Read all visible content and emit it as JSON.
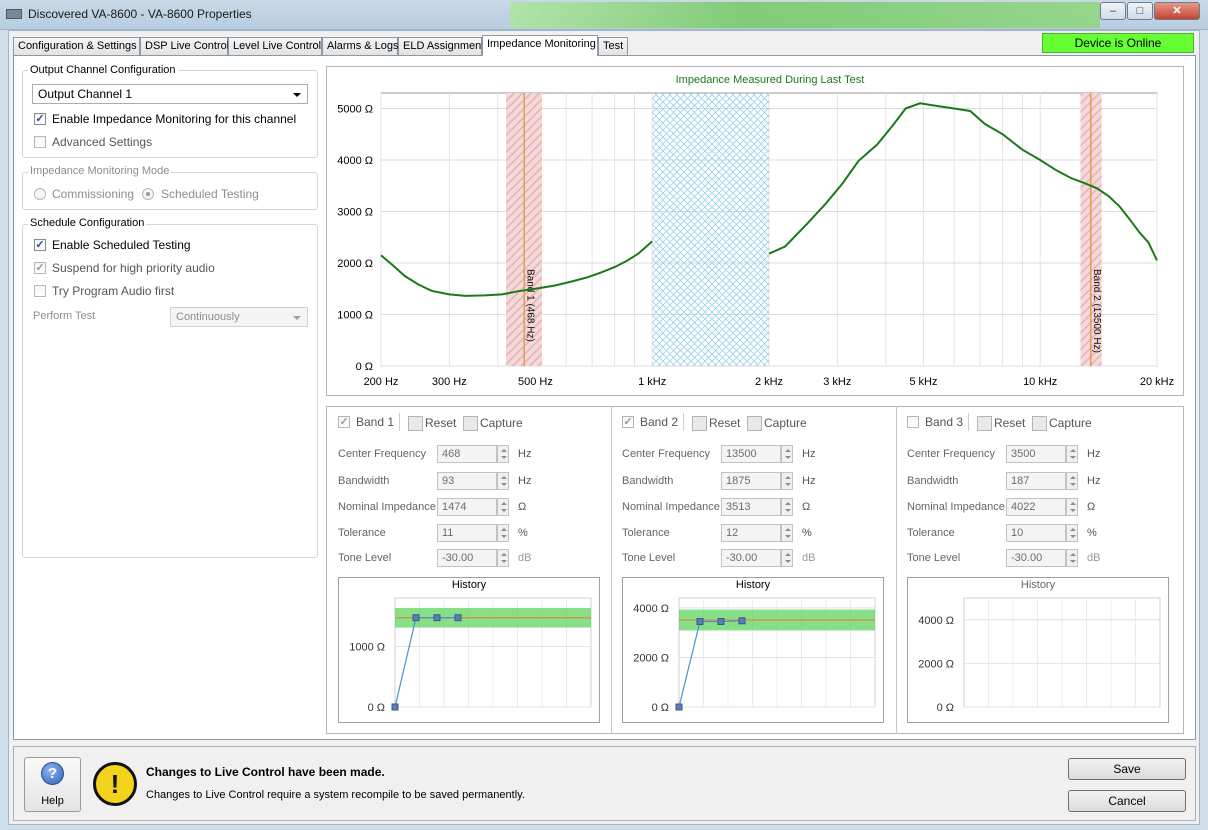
{
  "window": {
    "title": "Discovered VA-8600 - VA-8600 Properties",
    "controls": {
      "minimize": "–",
      "maximize": "□",
      "close": "✕"
    }
  },
  "tabs": [
    {
      "label": "Configuration & Settings"
    },
    {
      "label": "DSP Live Control"
    },
    {
      "label": "Level Live Control"
    },
    {
      "label": "Alarms & Logs"
    },
    {
      "label": "ELD Assignment"
    },
    {
      "label": "Impedance Monitoring",
      "active": true
    },
    {
      "label": "Test"
    }
  ],
  "status_badge": "Device is Online",
  "colors": {
    "online": "#66ff33",
    "curve": "#1a7a1a",
    "band_marker": "#e69b4f",
    "band_fill": "#e7b1b1",
    "hatch": "#9bd0e8",
    "tolerance": "#5fd65f"
  },
  "output_channel": {
    "group_label": "Output Channel Configuration",
    "selected": "Output Channel 1",
    "enable_label": "Enable Impedance Monitoring for this channel",
    "enable_checked": true,
    "advanced_label": "Advanced Settings",
    "advanced_checked": false
  },
  "monitoring_mode": {
    "group_label": "Impedance Monitoring Mode",
    "commissioning": "Commissioning",
    "scheduled": "Scheduled Testing",
    "selected": "Scheduled Testing"
  },
  "schedule": {
    "group_label": "Schedule Configuration",
    "enable_label": "Enable Scheduled Testing",
    "enable_checked": true,
    "suspend_label": "Suspend for high priority audio",
    "suspend_checked": true,
    "program_label": "Try Program Audio first",
    "program_checked": false,
    "perform_label": "Perform Test",
    "perform_value": "Continuously"
  },
  "chart_data": {
    "type": "line",
    "title": "Impedance Measured During Last Test",
    "x_scale": "log",
    "xlim": [
      200,
      20000
    ],
    "ylim": [
      0,
      5300
    ],
    "x_ticks": [
      {
        "v": 200,
        "label": "200 Hz"
      },
      {
        "v": 300,
        "label": "300 Hz"
      },
      {
        "v": 500,
        "label": "500 Hz"
      },
      {
        "v": 1000,
        "label": "1 kHz"
      },
      {
        "v": 2000,
        "label": "2 kHz"
      },
      {
        "v": 3000,
        "label": "3 kHz"
      },
      {
        "v": 5000,
        "label": "5 kHz"
      },
      {
        "v": 10000,
        "label": "10 kHz"
      },
      {
        "v": 20000,
        "label": "20 kHz"
      }
    ],
    "y_ticks": [
      {
        "v": 0,
        "label": "0 Ω"
      },
      {
        "v": 1000,
        "label": "1000 Ω"
      },
      {
        "v": 2000,
        "label": "2000 Ω"
      },
      {
        "v": 3000,
        "label": "3000 Ω"
      },
      {
        "v": 4000,
        "label": "4000 Ω"
      },
      {
        "v": 5000,
        "label": "5000 Ω"
      }
    ],
    "grid": true,
    "series": [
      {
        "segments": [
          [
            [
              200,
              2150
            ],
            [
              215,
              1950
            ],
            [
              230,
              1750
            ],
            [
              250,
              1580
            ],
            [
              270,
              1460
            ],
            [
              300,
              1390
            ],
            [
              330,
              1360
            ],
            [
              370,
              1370
            ],
            [
              410,
              1390
            ],
            [
              450,
              1450
            ],
            [
              500,
              1500
            ],
            [
              560,
              1560
            ],
            [
              620,
              1640
            ],
            [
              680,
              1720
            ],
            [
              740,
              1820
            ],
            [
              800,
              1920
            ],
            [
              860,
              2040
            ],
            [
              920,
              2180
            ],
            [
              960,
              2300
            ],
            [
              1000,
              2420
            ]
          ],
          [
            [
              2000,
              2180
            ],
            [
              2200,
              2320
            ],
            [
              2500,
              2750
            ],
            [
              2800,
              3150
            ],
            [
              3100,
              3550
            ],
            [
              3400,
              3980
            ],
            [
              3800,
              4300
            ],
            [
              4200,
              4700
            ],
            [
              4500,
              5000
            ],
            [
              4900,
              5100
            ],
            [
              5400,
              5050
            ],
            [
              6000,
              5000
            ],
            [
              6600,
              4950
            ],
            [
              7200,
              4700
            ],
            [
              8000,
              4500
            ],
            [
              9000,
              4200
            ],
            [
              10000,
              4000
            ],
            [
              11000,
              3800
            ],
            [
              12000,
              3650
            ],
            [
              13000,
              3550
            ],
            [
              14000,
              3450
            ],
            [
              15000,
              3300
            ],
            [
              16000,
              3100
            ],
            [
              17000,
              2850
            ],
            [
              18000,
              2600
            ],
            [
              19000,
              2400
            ],
            [
              20000,
              2050
            ]
          ]
        ]
      }
    ],
    "bands": [
      {
        "label": "Band 1 (468 Hz)",
        "center": 468,
        "low": 420,
        "high": 520
      },
      {
        "label": "Band 2 (13500 Hz)",
        "center": 13500,
        "low": 12700,
        "high": 14400
      }
    ],
    "excluded_region": [
      1000,
      2000
    ]
  },
  "band_panels": [
    {
      "name": "Band 1",
      "checked": true,
      "enabled": true,
      "reset": "Reset",
      "capture": "Capture",
      "center_label": "Center Frequency",
      "center": "468",
      "center_unit": "Hz",
      "bw_label": "Bandwidth",
      "bw": "93",
      "bw_unit": "Hz",
      "nom_label": "Nominal Impedance",
      "nom": "1474",
      "nom_unit": "Ω",
      "tol_label": "Tolerance",
      "tol": "11",
      "tol_unit": "%",
      "tone_label": "Tone Level",
      "tone": "-30.00",
      "tone_unit": "dB",
      "history": {
        "title": "History",
        "ylim": [
          0,
          1800
        ],
        "y_ticks": [
          {
            "v": 0,
            "label": "0 Ω"
          },
          {
            "v": 1000,
            "label": "1000 Ω"
          }
        ],
        "nominal": 1474,
        "tolerance": 11,
        "points": [
          0,
          1474,
          1474,
          1474
        ]
      }
    },
    {
      "name": "Band 2",
      "checked": true,
      "enabled": true,
      "reset": "Reset",
      "capture": "Capture",
      "center_label": "Center Frequency",
      "center": "13500",
      "center_unit": "Hz",
      "bw_label": "Bandwidth",
      "bw": "1875",
      "bw_unit": "Hz",
      "nom_label": "Nominal Impedance",
      "nom": "3513",
      "nom_unit": "Ω",
      "tol_label": "Tolerance",
      "tol": "12",
      "tol_unit": "%",
      "tone_label": "Tone Level",
      "tone": "-30.00",
      "tone_unit": "dB",
      "history": {
        "title": "History",
        "ylim": [
          0,
          4400
        ],
        "y_ticks": [
          {
            "v": 0,
            "label": "0 Ω"
          },
          {
            "v": 2000,
            "label": "2000 Ω"
          },
          {
            "v": 4000,
            "label": "4000 Ω"
          }
        ],
        "nominal": 3513,
        "tolerance": 12,
        "points": [
          0,
          3450,
          3450,
          3480
        ]
      }
    },
    {
      "name": "Band 3",
      "checked": false,
      "enabled": false,
      "reset": "Reset",
      "capture": "Capture",
      "center_label": "Center Frequency",
      "center": "3500",
      "center_unit": "Hz",
      "bw_label": "Bandwidth",
      "bw": "187",
      "bw_unit": "Hz",
      "nom_label": "Nominal Impedance",
      "nom": "4022",
      "nom_unit": "Ω",
      "tol_label": "Tolerance",
      "tol": "10",
      "tol_unit": "%",
      "tone_label": "Tone Level",
      "tone": "-30.00",
      "tone_unit": "dB",
      "history": {
        "title": "History",
        "ylim": [
          0,
          5000
        ],
        "y_ticks": [
          {
            "v": 0,
            "label": "0 Ω"
          },
          {
            "v": 2000,
            "label": "2000 Ω"
          },
          {
            "v": 4000,
            "label": "4000 Ω"
          }
        ],
        "nominal": null,
        "tolerance": null,
        "points": []
      }
    }
  ],
  "footer": {
    "help": "Help",
    "help_glyph": "?",
    "warning_glyph": "!",
    "message_title": "Changes to Live Control have been made.",
    "message_body": "Changes to Live Control require a system recompile to be saved permanently.",
    "save": "Save",
    "cancel": "Cancel"
  }
}
